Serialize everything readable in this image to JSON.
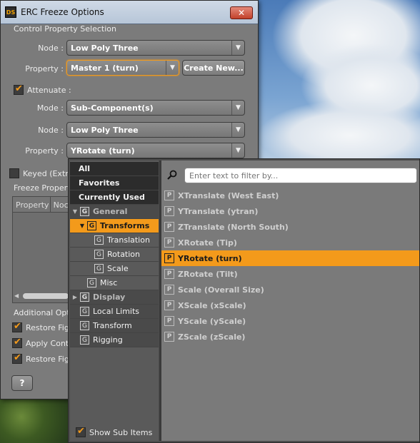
{
  "dialog": {
    "title": "ERC Freeze Options",
    "app_icon": "DS",
    "close_glyph": "✕",
    "section_control": "Control Property Selection",
    "node_label": "Node :",
    "node_value": "Low Poly Three",
    "property_label": "Property :",
    "property_value": "Master 1 (turn)",
    "create_new": "Create New...",
    "attenuate_label": "Attenuate :",
    "mode_label": "Mode :",
    "mode_value": "Sub-Component(s)",
    "node2_value": "Low Poly Three",
    "property2_value": "YRotate (turn)",
    "keyed_label": "Keyed (Extra",
    "freeze_section": "Freeze Properti",
    "table_col_property": "Property",
    "table_col_node": "Noc",
    "additional_options": "Additional Optio",
    "restore_figure_1": "Restore Figu",
    "apply_control": "Apply Contr",
    "restore_figure_2": "Restore Figu",
    "help_button": "?",
    "arrow_glyph": "▼"
  },
  "popup": {
    "search_placeholder": "Enter text to filter by...",
    "show_sub_items": "Show Sub Items",
    "tree": [
      {
        "label": "All"
      },
      {
        "label": "Favorites"
      },
      {
        "label": "Currently Used"
      },
      {
        "label": "General"
      },
      {
        "label": "Transforms"
      },
      {
        "label": "Translation"
      },
      {
        "label": "Rotation"
      },
      {
        "label": "Scale"
      },
      {
        "label": "Misc"
      },
      {
        "label": "Display"
      },
      {
        "label": "Local Limits"
      },
      {
        "label": "Transform"
      },
      {
        "label": "Rigging"
      }
    ],
    "properties": [
      "XTranslate (West   East)",
      "YTranslate (ytran)",
      "ZTranslate (North   South)",
      "XRotate (Tip)",
      "YRotate (turn)",
      "ZRotate (Tilt)",
      "Scale (Overall Size)",
      "XScale (xScale)",
      "YScale (yScale)",
      "ZScale (zScale)"
    ],
    "selected_property": "YRotate (turn)",
    "group_glyph": "G",
    "prop_glyph": "P",
    "expanded_glyph": "▼",
    "collapsed_glyph": "▶"
  },
  "colors": {
    "accent": "#f39a1b",
    "panel": "#7b7b7b"
  }
}
